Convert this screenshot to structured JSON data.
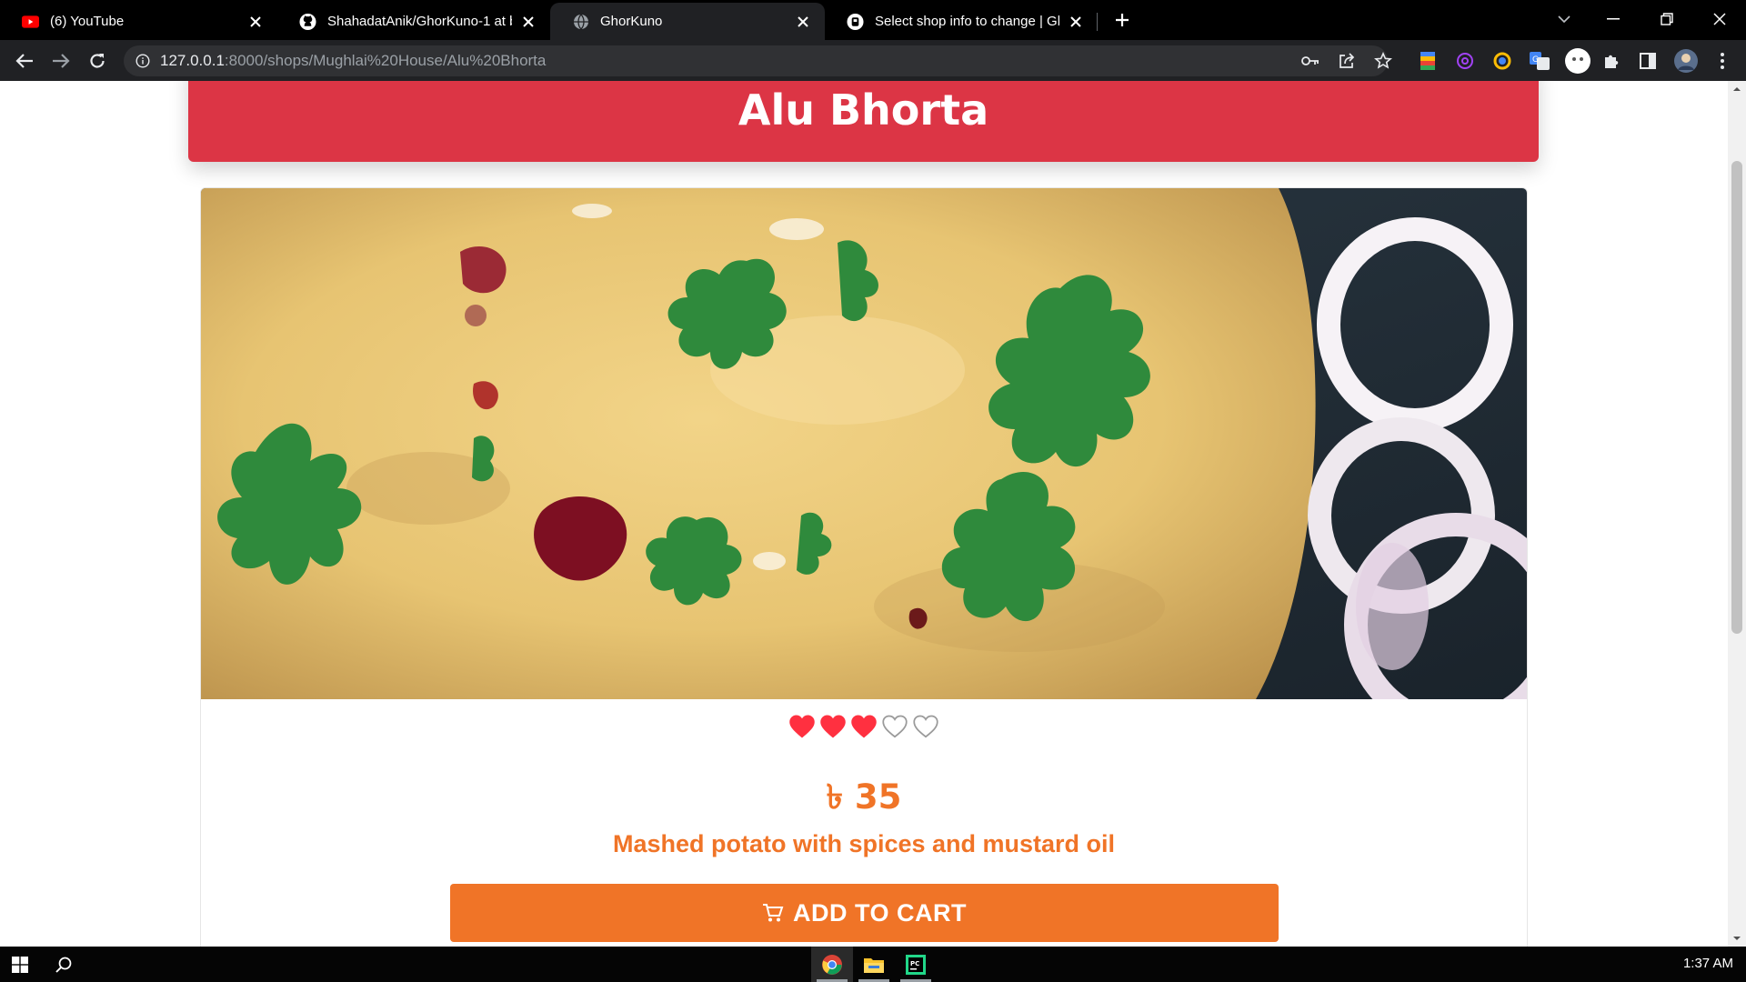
{
  "browser": {
    "tabs": [
      {
        "title": "(6) YouTube",
        "icon": "youtube-icon",
        "active": false
      },
      {
        "title": "ShahadatAnik/GhorKuno-1 at ba",
        "icon": "github-icon",
        "active": false
      },
      {
        "title": "GhorKuno",
        "icon": "globe-icon",
        "active": true
      },
      {
        "title": "Select shop info to change | Gho",
        "icon": "django-admin-icon",
        "active": false
      }
    ],
    "url_host": "127.0.0.1",
    "url_path": ":8000/shops/Mughlai%20House/Alu%20Bhorta"
  },
  "page": {
    "food_name": "Alu Bhorta",
    "rating": {
      "filled": 3,
      "total": 5
    },
    "price": "৳ 35",
    "description": "Mashed potato with spices and mustard oil",
    "add_to_cart_label": "ADD TO CART"
  },
  "taskbar": {
    "clock": "1:37 AM"
  },
  "colors": {
    "header_red": "#dc3545",
    "accent_orange": "#f07427",
    "heart_red": "#ff3040"
  }
}
